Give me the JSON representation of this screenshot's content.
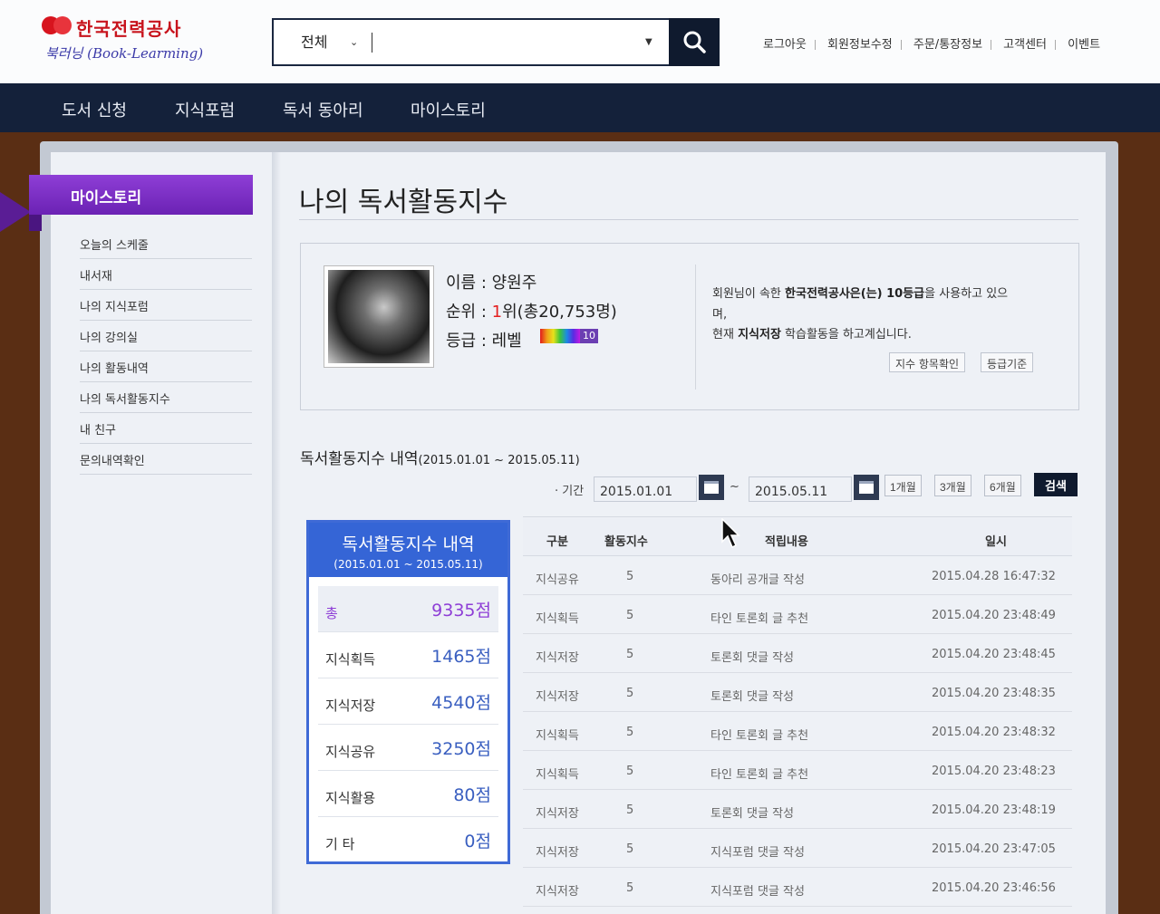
{
  "logo": {
    "title": "한국전력공사",
    "subtitle": "북러닝 (Book-Learming)"
  },
  "search": {
    "scope": "전체",
    "value": "",
    "placeholder": ""
  },
  "util_links": [
    "로그아웃",
    "회원정보수정",
    "주문/통장정보",
    "고객센터",
    "이벤트"
  ],
  "nav": [
    "도서 신청",
    "지식포럼",
    "독서 동아리",
    "마이스토리"
  ],
  "sidebar": {
    "title": "마이스토리",
    "items": [
      "오늘의 스케줄",
      "내서재",
      "나의 지식포럼",
      "나의 강의실",
      "나의 활동내역",
      "나의 독서활동지수",
      "내 친구",
      "문의내역확인"
    ]
  },
  "page": {
    "title": "나의 독서활동지수"
  },
  "profile": {
    "name_line": "이름 : 양원주",
    "rank_prefix": "순위 : ",
    "rank_num": "1",
    "rank_suffix": "위(총20,753명)",
    "grade_line": "등급 : 레벨",
    "level": "10",
    "msg1_a": "회원님이 속한 ",
    "msg1_b": "한국전력공사은(는) 10등급",
    "msg1_c": "을 사용하고 있으",
    "msg2": "며,",
    "msg3_a": "현재 ",
    "msg3_b": "지식저장",
    "msg3_c": " 학습활동을 하고계십니다.",
    "btn1": "지수 항목확인",
    "btn2": "등급기준"
  },
  "history": {
    "title": "독서활동지수 내역",
    "range": "(2015.01.01 ~ 2015.05.11)",
    "filter_label": "· 기간",
    "date_from": "2015.01.01",
    "tilde": "~",
    "date_to": "2015.05.11",
    "ranges": [
      "1개월",
      "3개월",
      "6개월"
    ],
    "search_btn": "검색"
  },
  "scores": {
    "title": "독서활동지수 내역",
    "range": "(2015.01.01 ~ 2015.05.11)",
    "rows": [
      {
        "k": "총",
        "v": "9335점"
      },
      {
        "k": "지식획득",
        "v": "1465점"
      },
      {
        "k": "지식저장",
        "v": "4540점"
      },
      {
        "k": "지식공유",
        "v": "3250점"
      },
      {
        "k": "지식활용",
        "v": "80점"
      },
      {
        "k": "기 타",
        "v": "0점"
      }
    ]
  },
  "table": {
    "headers": [
      "구분",
      "활동지수",
      "적립내용",
      "일시"
    ],
    "rows": [
      [
        "지식공유",
        "5",
        "동아리 공개글 작성",
        "2015.04.28 16:47:32"
      ],
      [
        "지식획득",
        "5",
        "타인 토론회 글 추천",
        "2015.04.20 23:48:49"
      ],
      [
        "지식저장",
        "5",
        "토론회 댓글 작성",
        "2015.04.20 23:48:45"
      ],
      [
        "지식저장",
        "5",
        "토론회 댓글 작성",
        "2015.04.20 23:48:35"
      ],
      [
        "지식획득",
        "5",
        "타인 토론회 글 추천",
        "2015.04.20 23:48:32"
      ],
      [
        "지식획득",
        "5",
        "타인 토론회 글 추천",
        "2015.04.20 23:48:23"
      ],
      [
        "지식저장",
        "5",
        "토론회 댓글 작성",
        "2015.04.20 23:48:19"
      ],
      [
        "지식저장",
        "5",
        "지식포럼 댓글 작성",
        "2015.04.20 23:47:05"
      ],
      [
        "지식저장",
        "5",
        "지식포럼 댓글 작성",
        "2015.04.20 23:46:56"
      ]
    ]
  }
}
